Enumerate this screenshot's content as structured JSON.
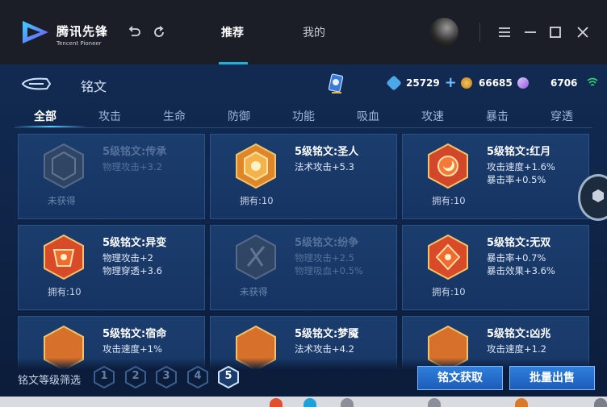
{
  "app": {
    "brand_cn": "腾讯先锋",
    "brand_en": "Tencent Pioneer",
    "nav": {
      "recommend": "推荐",
      "mine": "我的"
    }
  },
  "header": {
    "title": "铭文",
    "currencies": [
      {
        "icon": "diamond-icon",
        "value": "25729",
        "color": "#4aa8e8"
      },
      {
        "icon": "gold-coin-icon",
        "value": "66685",
        "color": "#e0a23a"
      },
      {
        "icon": "crystal-icon",
        "value": "6706",
        "color": "#c39cf2"
      }
    ]
  },
  "tabs": [
    "全部",
    "攻击",
    "生命",
    "防御",
    "功能",
    "吸血",
    "攻速",
    "暴击",
    "穿透"
  ],
  "cards": [
    {
      "name": "5级铭文:传承",
      "attrs": [
        "物理攻击+3.2"
      ],
      "owned": "未获得",
      "obtained": false,
      "color": "#b0462a"
    },
    {
      "name": "5级铭文:圣人",
      "attrs": [
        "法术攻击+5.3"
      ],
      "owned": "拥有:10",
      "obtained": true,
      "color": "#e0862a"
    },
    {
      "name": "5级铭文:红月",
      "attrs": [
        "攻击速度+1.6%",
        "暴击率+0.5%"
      ],
      "owned": "拥有:10",
      "obtained": true,
      "color": "#d2462a"
    },
    {
      "name": "5级铭文:异变",
      "attrs": [
        "物理攻击+2",
        "物理穿透+3.6"
      ],
      "owned": "拥有:10",
      "obtained": true,
      "color": "#d84a28"
    },
    {
      "name": "5级铭文:纷争",
      "attrs": [
        "物理攻击+2.5",
        "物理吸血+0.5%"
      ],
      "owned": "未获得",
      "obtained": false,
      "color": "#b0462a"
    },
    {
      "name": "5级铭文:无双",
      "attrs": [
        "暴击率+0.7%",
        "暴击效果+3.6%"
      ],
      "owned": "拥有:10",
      "obtained": true,
      "color": "#d84a28"
    },
    {
      "name": "5级铭文:宿命",
      "attrs": [
        "攻击速度+1%"
      ],
      "owned": "",
      "obtained": true,
      "color": "#d6702a"
    },
    {
      "name": "5级铭文:梦魇",
      "attrs": [
        "法术攻击+4.2"
      ],
      "owned": "",
      "obtained": true,
      "color": "#d6702a"
    },
    {
      "name": "5级铭文:凶兆",
      "attrs": [
        "攻击速度+1.2"
      ],
      "owned": "",
      "obtained": true,
      "color": "#d6702a"
    }
  ],
  "bottom": {
    "filter_label": "铭文等级筛选",
    "levels": [
      "1",
      "2",
      "3",
      "4",
      "5"
    ],
    "active_level": "5",
    "obtain_button": "铭文获取",
    "sell_button": "批量出售"
  }
}
